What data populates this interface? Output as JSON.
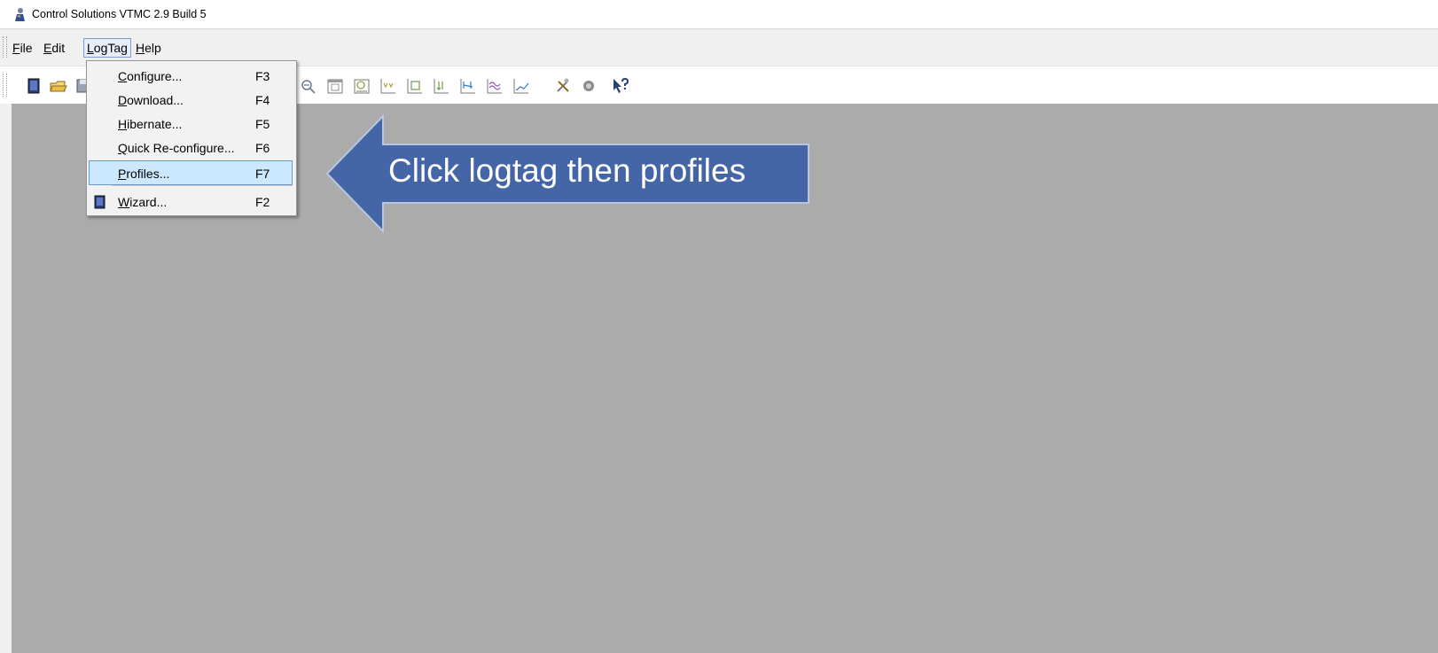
{
  "window": {
    "title": "Control Solutions VTMC 2.9 Build 5",
    "icon": "app-person-icon"
  },
  "menubar": {
    "items": [
      {
        "label_mnemonic": "F",
        "label_rest": "ile"
      },
      {
        "label_mnemonic": "E",
        "label_rest": "dit"
      },
      {
        "label_mnemonic": "L",
        "label_rest": "ogTag"
      },
      {
        "label_mnemonic": "H",
        "label_rest": "elp"
      }
    ],
    "active": "LogTag"
  },
  "dropdown": {
    "items": [
      {
        "mnemonic": "C",
        "rest": "onfigure...",
        "accel": "F3"
      },
      {
        "mnemonic": "D",
        "rest": "ownload...",
        "accel": "F4"
      },
      {
        "mnemonic": "H",
        "rest": "ibernate...",
        "accel": "F5"
      },
      {
        "mnemonic": "Q",
        "rest": "uick Re-configure...",
        "accel": "F6"
      },
      {
        "mnemonic": "P",
        "rest": "rofiles...",
        "accel": "F7"
      },
      {
        "mnemonic": "W",
        "rest": "izard...",
        "accel": "F2"
      }
    ],
    "highlighted": "Profiles..."
  },
  "toolbar": {
    "icons": [
      "new-file-icon",
      "open-folder-icon",
      "save-icon",
      "zoom-icon",
      "calendar-icon",
      "report-icon",
      "chart-a-icon",
      "chart-b-icon",
      "chart-c-icon",
      "chart-d-icon",
      "wave-chart-icon",
      "line-chart-icon",
      "tools-icon",
      "logtag-icon",
      "help-pointer-icon"
    ]
  },
  "callout": {
    "text": "Click logtag then profiles",
    "color": "#4466a6"
  },
  "colors": {
    "workspace": "#ababab",
    "menu_highlight": "#cce8ff"
  }
}
